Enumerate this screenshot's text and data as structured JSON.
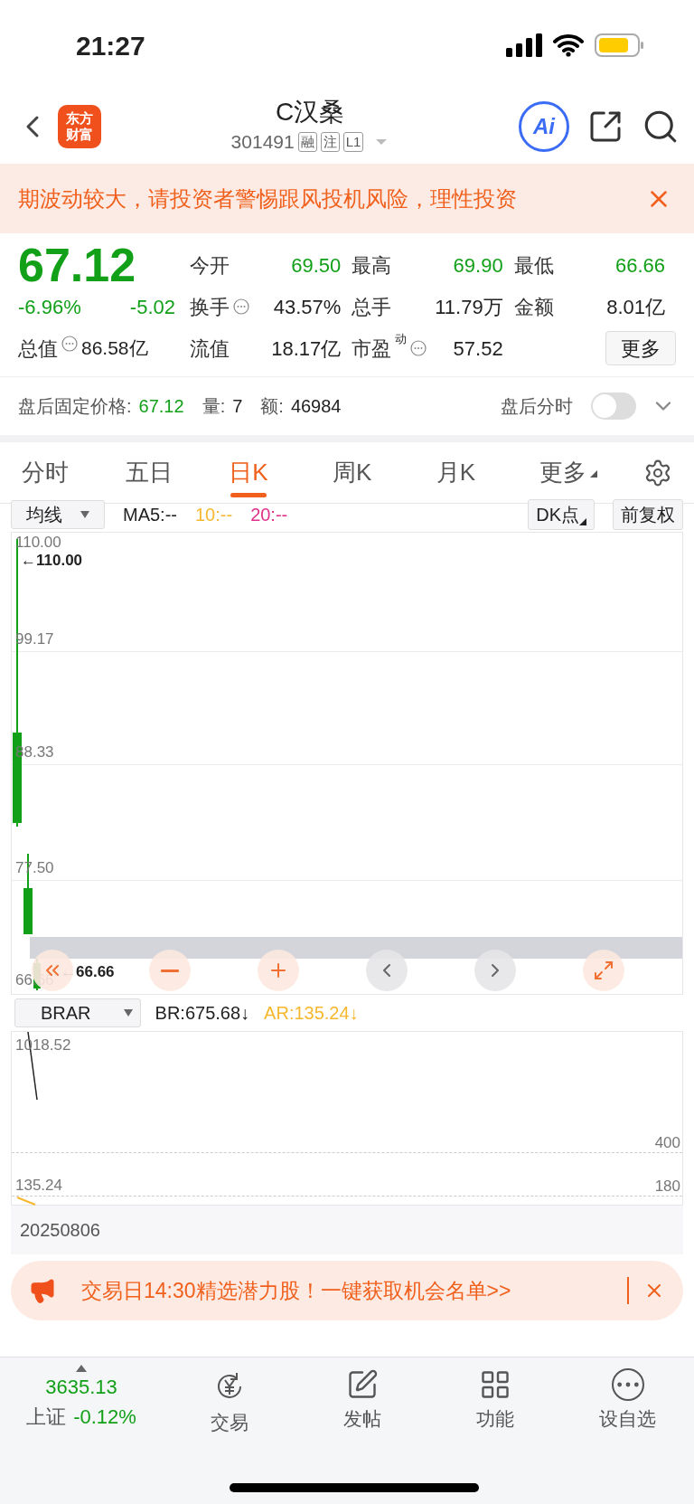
{
  "status_bar": {
    "time": "21:27"
  },
  "header": {
    "logo": [
      "东方",
      "财富"
    ],
    "title": "C汉桑",
    "code": "301491",
    "badges": [
      "融",
      "注",
      "L1"
    ],
    "ai_label": "Ai"
  },
  "risk_banner": {
    "text": "期波动较大，请投资者警惕跟风投机风险，理性投资"
  },
  "quote": {
    "price": "67.12",
    "change_pct": "-6.96%",
    "change": "-5.02",
    "market_cap": {
      "label": "总值",
      "value": "86.58亿",
      "info": true
    },
    "stats": [
      {
        "label": "今开",
        "value": "69.50",
        "color": "#12a019",
        "info": false
      },
      {
        "label": "最高",
        "value": "69.90",
        "color": "#12a019",
        "info": false
      },
      {
        "label": "最低",
        "value": "66.66",
        "color": "#12a019",
        "info": false
      },
      {
        "label": "换手",
        "value": "43.57%",
        "color": "#222222",
        "info": true
      },
      {
        "label": "总手",
        "value": "11.79万",
        "color": "#222222",
        "info": false
      },
      {
        "label": "金额",
        "value": "8.01亿",
        "color": "#222222",
        "info": false
      },
      {
        "label": "流值",
        "value": "18.17亿",
        "color": "#222222",
        "info": false
      },
      {
        "label": "市盈",
        "sup": "动",
        "value": "57.52",
        "color": "#222222",
        "info": true
      }
    ],
    "more_button": "更多"
  },
  "after_hours": {
    "label": "盘后固定价格:",
    "price": "67.12",
    "volume_label": "量:",
    "volume": "7",
    "amount_label": "额:",
    "amount": "46984",
    "timeshare_label": "盘后分时",
    "timeshare_on": false
  },
  "tabs": [
    {
      "label": "分时",
      "kind": "tab",
      "selected": false
    },
    {
      "label": "五日",
      "kind": "tab",
      "selected": false
    },
    {
      "label": "日K",
      "kind": "tab",
      "selected": true
    },
    {
      "label": "周K",
      "kind": "tab",
      "selected": false
    },
    {
      "label": "月K",
      "kind": "tab",
      "selected": false
    },
    {
      "label": "更多",
      "kind": "menu",
      "selected": false
    }
  ],
  "indicator_bar": {
    "select": "均线",
    "values": [
      {
        "text": "MA5:--",
        "color": "#222222"
      },
      {
        "text": "10:--",
        "color": "#f5b82e"
      },
      {
        "text": "20:--",
        "color": "#e0308a"
      }
    ],
    "dk_button": "DK点",
    "adjust_button": "前复权"
  },
  "price_chart": {
    "labels": [
      "110.00",
      "99.17",
      "88.33",
      "77.50",
      "66.66"
    ],
    "high_marker": "←110.00",
    "low_marker": "←66.66"
  },
  "sub_indicator": {
    "select": "BRAR",
    "values": [
      {
        "text": "BR:675.68↓",
        "color": "#222222"
      },
      {
        "text": "AR:135.24↓",
        "color": "#f5b82e"
      }
    ],
    "labels": [
      "1018.52",
      "135.24"
    ],
    "levels": [
      "400",
      "180"
    ],
    "date": "20250806"
  },
  "promo_banner": {
    "text": "交易日14:30精选潜力股！一键获取机会名单>>"
  },
  "bottom_bar": {
    "index": {
      "value": "3635.13",
      "name": "上证",
      "change": "-0.12%"
    },
    "items": [
      {
        "label": "交易",
        "kind": "trade"
      },
      {
        "label": "发帖",
        "kind": "post"
      },
      {
        "label": "功能",
        "kind": "apps"
      },
      {
        "label": "设自选",
        "kind": "watch"
      }
    ]
  }
}
